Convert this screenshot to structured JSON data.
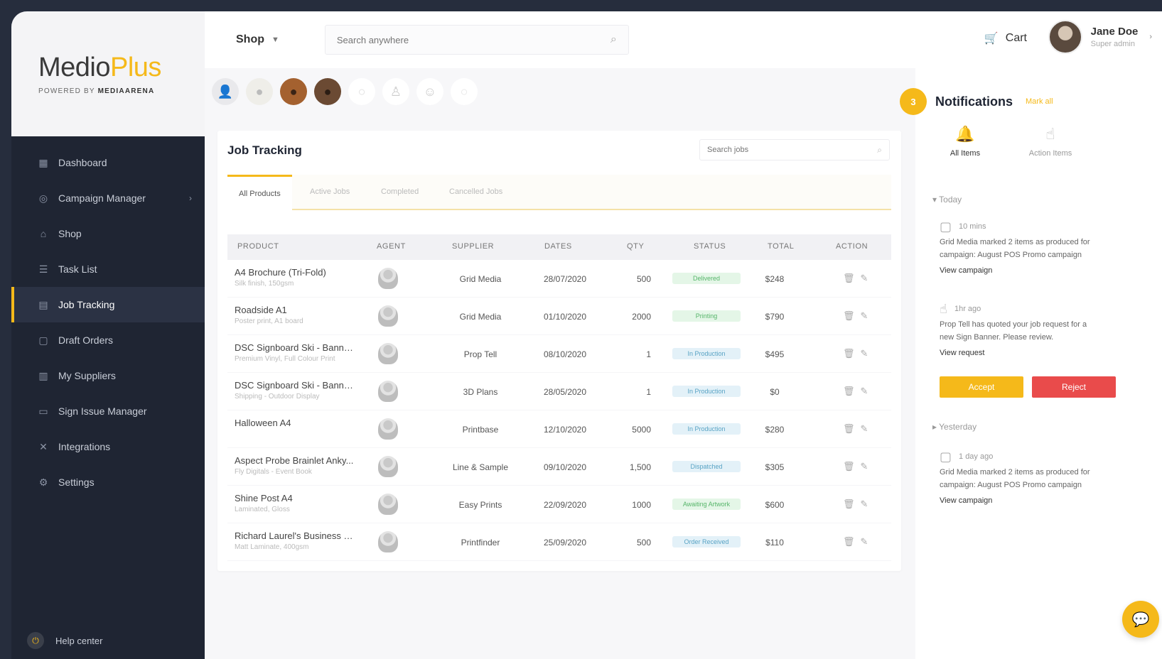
{
  "brand": {
    "name_part1": "Medio",
    "name_part2": "Plus",
    "tagline_prefix": "POWERED BY ",
    "tagline_strong": "MEDIAARENA"
  },
  "sidebar": {
    "items": [
      {
        "label": "Dashboard",
        "icon": "grid-icon"
      },
      {
        "label": "Campaign Manager",
        "icon": "target-icon",
        "has_chevron": true
      },
      {
        "label": "Shop",
        "icon": "bag-icon"
      },
      {
        "label": "Task List",
        "icon": "list-icon"
      },
      {
        "label": "Job Tracking",
        "icon": "tracking-icon",
        "active": true
      },
      {
        "label": "Draft Orders",
        "icon": "document-icon"
      },
      {
        "label": "My Suppliers",
        "icon": "store-icon"
      },
      {
        "label": "Sign Issue Manager",
        "icon": "monitor-icon"
      },
      {
        "label": "Integrations",
        "icon": "cross-icon"
      },
      {
        "label": "Settings",
        "icon": "gear-icon"
      }
    ],
    "logout_label": "Help center"
  },
  "topbar": {
    "shop_label": "Shop",
    "search_placeholder": "Search anywhere",
    "cart_label": "Cart",
    "user_name": "Jane Doe",
    "user_role": "Super admin"
  },
  "card": {
    "title": "Job Tracking",
    "search_placeholder": "Search jobs",
    "tabs": [
      "All Products",
      "Active Jobs",
      "Completed",
      "Cancelled Jobs"
    ],
    "columns": [
      "Product",
      "Agent",
      "Supplier",
      "Dates",
      "Qty",
      "Status",
      "Total",
      "Action"
    ],
    "rows": [
      {
        "product": "A4 Brochure (Tri-Fold)",
        "sub": "Silk finish, 150gsm",
        "supplier": "Grid Media",
        "date": "28/07/2020",
        "qty": "500",
        "status": "Delivered",
        "status_color": "green",
        "total": "$248"
      },
      {
        "product": "Roadside A1",
        "sub": "Poster print, A1 board",
        "supplier": "Grid Media",
        "date": "01/10/2020",
        "qty": "2000",
        "status": "Printing",
        "status_color": "green",
        "total": "$790"
      },
      {
        "product": "DSC Signboard Ski - Banner...",
        "sub": "Premium Vinyl, Full Colour Print",
        "supplier": "Prop Tell",
        "date": "08/10/2020",
        "qty": "1",
        "status": "In Production",
        "status_color": "blue",
        "total": "$495"
      },
      {
        "product": "DSC Signboard Ski - Banner...",
        "sub": "Shipping - Outdoor Display",
        "supplier": "3D Plans",
        "date": "28/05/2020",
        "qty": "1",
        "status": "In Production",
        "status_color": "blue",
        "total": "$0"
      },
      {
        "product": "Halloween A4",
        "sub": "",
        "supplier": "Printbase",
        "date": "12/10/2020",
        "qty": "5000",
        "status": "In Production",
        "status_color": "blue",
        "total": "$280"
      },
      {
        "product": "Aspect Probe Brainlet Anky...",
        "sub": "Fly Digitals - Event Book",
        "supplier": "Line & Sample",
        "date": "09/10/2020",
        "qty": "1,500",
        "status": "Dispatched",
        "status_color": "blue",
        "total": "$305"
      },
      {
        "product": "Shine Post A4",
        "sub": "Laminated, Gloss",
        "supplier": "Easy Prints",
        "date": "22/09/2020",
        "qty": "1000",
        "status": "Awaiting Artwork",
        "status_color": "green",
        "total": "$600"
      },
      {
        "product": "Richard Laurel's Business Cards",
        "sub": "Matt Laminate, 400gsm",
        "supplier": "Printfinder",
        "date": "25/09/2020",
        "qty": "500",
        "status": "Order Received",
        "status_color": "blue",
        "total": "$110"
      }
    ]
  },
  "notifications": {
    "count": "3",
    "title": "Notifications",
    "subtitle": "Mark all",
    "tabs": [
      "All Items",
      "Action Items"
    ],
    "today_label": "Today",
    "yesterday_label": "Yesterday",
    "cards": [
      {
        "time": "10 mins",
        "text": "Grid Media marked 2 items as produced for campaign: August POS Promo campaign",
        "link": "View campaign"
      },
      {
        "time": "1hr ago",
        "text": "Prop Tell has quoted your job request for a new Sign Banner. Please review.",
        "link": "View request"
      },
      {
        "time": "1 day ago",
        "text": "Grid Media marked 2 items as produced for campaign: August POS Promo campaign",
        "link": "View campaign"
      }
    ],
    "accept_label": "Accept",
    "reject_label": "Reject"
  }
}
